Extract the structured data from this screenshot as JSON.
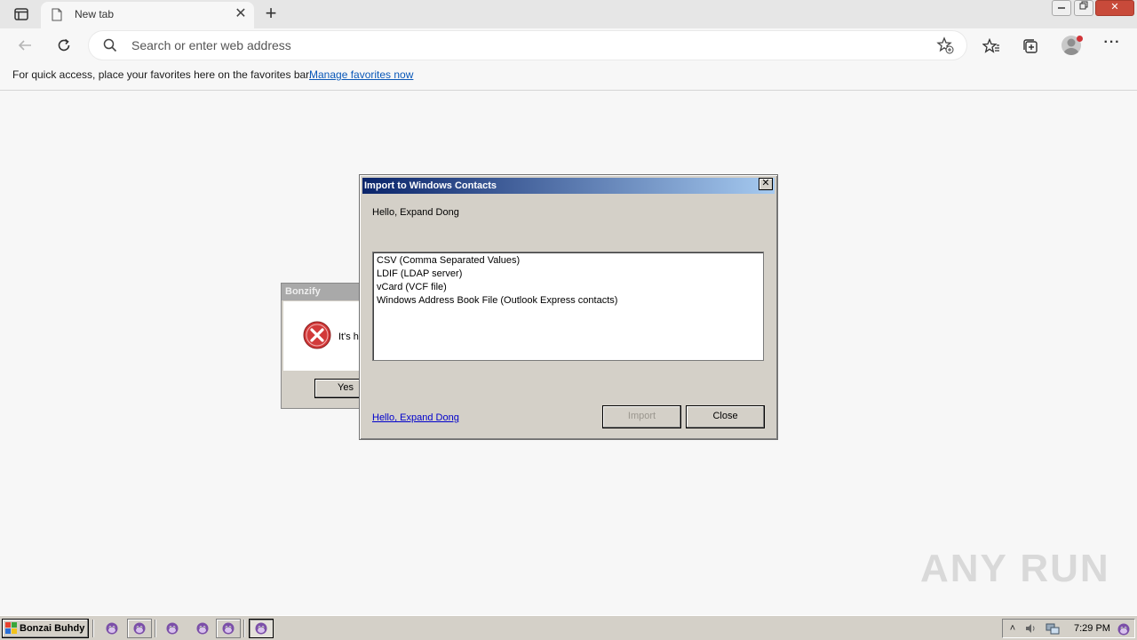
{
  "browser": {
    "tab": {
      "title": "New tab"
    },
    "address": {
      "placeholder": "Search or enter web address"
    },
    "favorites_bar": {
      "text": "For quick access, place your favorites here on the favorites bar.",
      "link": "Manage favorites now"
    }
  },
  "bonzify_dialog": {
    "title": "Bonzify",
    "message": "It's h",
    "yes_button": "Yes"
  },
  "import_dialog": {
    "title": "Import to Windows Contacts",
    "close_glyph": "✕",
    "greeting": "Hello, Expand Dong",
    "formats": [
      "CSV (Comma Separated Values)",
      "LDIF (LDAP server)",
      "vCard (VCF file)",
      "Windows Address Book File (Outlook Express contacts)"
    ],
    "link": "Hello, Expand Dong",
    "import_button": "Import",
    "close_button": "Close"
  },
  "watermark": {
    "text": "ANY RUN"
  },
  "taskbar": {
    "start_label": "Bonzai Buhdy",
    "clock": "7:29 PM"
  },
  "colors": {
    "title_gradient_start": "#0a246a",
    "title_gradient_end": "#a6caf0",
    "dialog_face": "#d4d0c8",
    "error_red": "#d23a3a",
    "link_blue": "#0a58b8"
  },
  "icons": {
    "bonzi": "bonzi-gorilla-icon",
    "error": "error-icon"
  }
}
